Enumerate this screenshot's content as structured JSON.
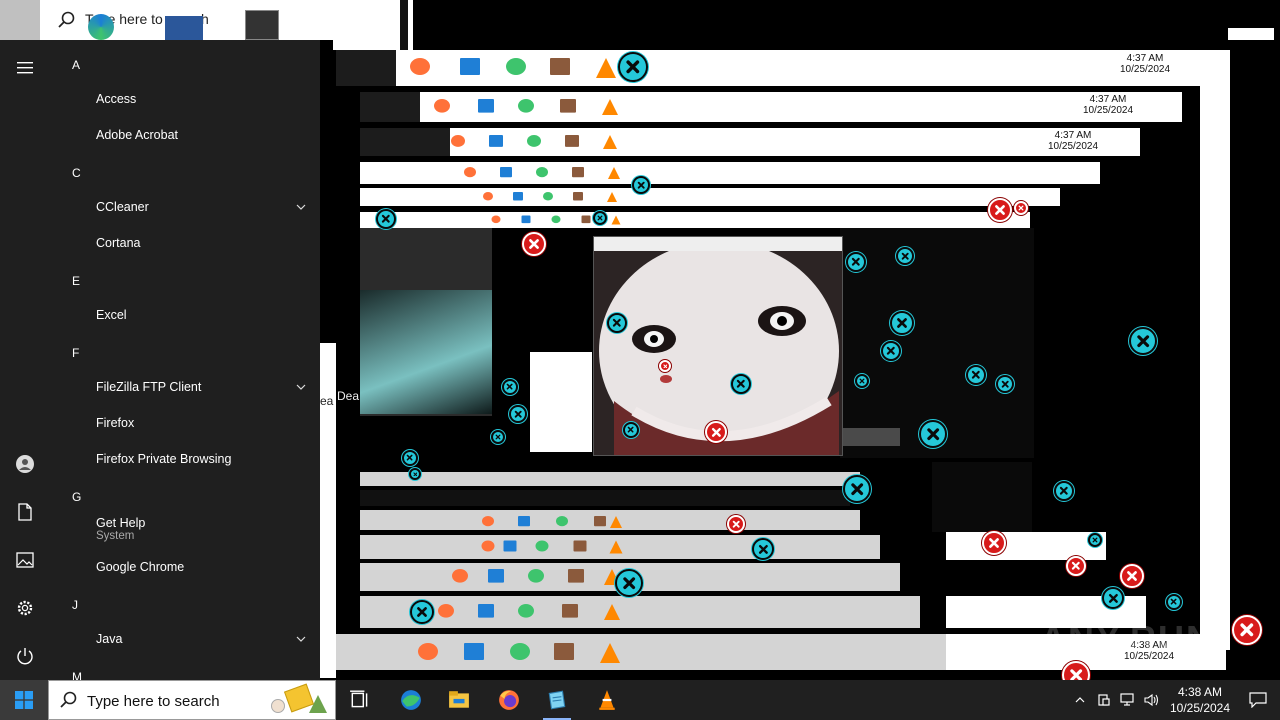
{
  "start_menu": {
    "sections": [
      {
        "letter": "A",
        "apps": [
          {
            "label": "Access"
          },
          {
            "label": "Adobe Acrobat"
          }
        ]
      },
      {
        "letter": "C",
        "apps": [
          {
            "label": "CCleaner",
            "expandable": true
          },
          {
            "label": "Cortana"
          }
        ]
      },
      {
        "letter": "E",
        "apps": [
          {
            "label": "Excel"
          }
        ]
      },
      {
        "letter": "F",
        "apps": [
          {
            "label": "FileZilla FTP Client",
            "expandable": true
          },
          {
            "label": "Firefox"
          },
          {
            "label": "Firefox Private Browsing"
          }
        ]
      },
      {
        "letter": "G",
        "apps": [
          {
            "label": "Get Help",
            "sub": "System"
          },
          {
            "label": "Google Chrome"
          }
        ]
      },
      {
        "letter": "J",
        "apps": [
          {
            "label": "Java",
            "expandable": true
          }
        ]
      },
      {
        "letter": "M",
        "apps": []
      }
    ],
    "rail_icons": [
      "hamburger-icon",
      "user-icon",
      "documents-icon",
      "pictures-icon",
      "settings-icon",
      "power-icon"
    ]
  },
  "top_ghost_search": {
    "text": "Type here to search"
  },
  "taskbar": {
    "search_placeholder": "Type here to search",
    "pinned_icons": [
      "task-view-icon",
      "edge-icon",
      "file-explorer-icon",
      "firefox-icon",
      "notepad-icon",
      "vlc-icon"
    ],
    "tray": {
      "time": "4:38 AM",
      "date": "10/25/2024"
    }
  },
  "ghost_clocks": [
    {
      "time": "4:37 AM",
      "date": "10/25/2024"
    },
    {
      "time": "4:37 AM",
      "date": "10/25/2024"
    },
    {
      "time": "4:37 AM",
      "date": "10/25/2024"
    },
    {
      "time": "4:38 AM",
      "date": "10/25/2024"
    }
  ],
  "stray_text": {
    "dea": "Dea",
    "ea": "ea"
  },
  "colors": {
    "taskbar_bg": "#202020",
    "start_menu_bg": "#1f1f1f",
    "cyan_close": "#25c8d9",
    "red_close": "#d81b1b",
    "accent": "#0078d7"
  },
  "watermark": "ANY.RUN"
}
